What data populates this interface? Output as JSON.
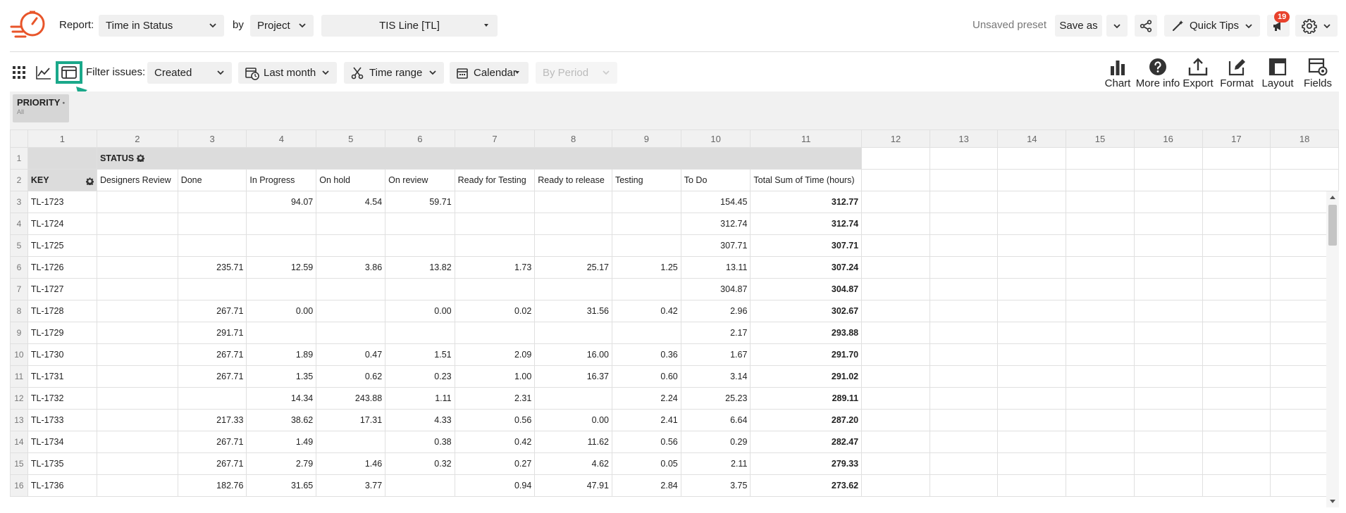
{
  "header": {
    "report_label": "Report:",
    "report_value": "Time in Status",
    "by_label": "by",
    "by_value": "Project",
    "project_value": "TIS Line [TL]",
    "unsaved_preset": "Unsaved preset",
    "save_as": "Save as",
    "quick_tips": "Quick Tips",
    "notification_count": "19"
  },
  "toolbar": {
    "filter_label": "Filter issues:",
    "filter_value": "Created",
    "date_range": "Last month",
    "time_range": "Time range",
    "calendar": "Calendar",
    "by_period": "By Period",
    "actions": {
      "chart": "Chart",
      "more_info": "More info",
      "export": "Export",
      "format": "Format",
      "layout": "Layout",
      "fields": "Fields"
    }
  },
  "filter_pill": {
    "title": "PRIORITY",
    "sub": "All"
  },
  "grid": {
    "col_numbers": [
      "1",
      "2",
      "3",
      "4",
      "5",
      "6",
      "7",
      "8",
      "9",
      "10",
      "11",
      "12",
      "13",
      "14",
      "15",
      "16",
      "17",
      "18"
    ],
    "status_label": "STATUS",
    "key_label": "KEY",
    "columns": [
      "Designers Review",
      "Done",
      "In Progress",
      "On hold",
      "On review",
      "Ready for Testing",
      "Ready to release",
      "Testing",
      "To Do",
      "Total Sum of Time (hours)"
    ],
    "rows": [
      {
        "n": "3",
        "key": "TL-1723",
        "v": [
          "",
          "",
          "94.07",
          "4.54",
          "59.71",
          "",
          "",
          "",
          "154.45",
          "312.77"
        ]
      },
      {
        "n": "4",
        "key": "TL-1724",
        "v": [
          "",
          "",
          "",
          "",
          "",
          "",
          "",
          "",
          "312.74",
          "312.74"
        ]
      },
      {
        "n": "5",
        "key": "TL-1725",
        "v": [
          "",
          "",
          "",
          "",
          "",
          "",
          "",
          "",
          "307.71",
          "307.71"
        ]
      },
      {
        "n": "6",
        "key": "TL-1726",
        "v": [
          "",
          "235.71",
          "12.59",
          "3.86",
          "13.82",
          "1.73",
          "25.17",
          "1.25",
          "13.11",
          "307.24"
        ]
      },
      {
        "n": "7",
        "key": "TL-1727",
        "v": [
          "",
          "",
          "",
          "",
          "",
          "",
          "",
          "",
          "304.87",
          "304.87"
        ]
      },
      {
        "n": "8",
        "key": "TL-1728",
        "v": [
          "",
          "267.71",
          "0.00",
          "",
          "0.00",
          "0.02",
          "31.56",
          "0.42",
          "2.96",
          "302.67"
        ]
      },
      {
        "n": "9",
        "key": "TL-1729",
        "v": [
          "",
          "291.71",
          "",
          "",
          "",
          "",
          "",
          "",
          "2.17",
          "293.88"
        ]
      },
      {
        "n": "10",
        "key": "TL-1730",
        "v": [
          "",
          "267.71",
          "1.89",
          "0.47",
          "1.51",
          "2.09",
          "16.00",
          "0.36",
          "1.67",
          "291.70"
        ]
      },
      {
        "n": "11",
        "key": "TL-1731",
        "v": [
          "",
          "267.71",
          "1.35",
          "0.62",
          "0.23",
          "1.00",
          "16.37",
          "0.60",
          "3.14",
          "291.02"
        ]
      },
      {
        "n": "12",
        "key": "TL-1732",
        "v": [
          "",
          "",
          "14.34",
          "243.88",
          "1.11",
          "2.31",
          "",
          "2.24",
          "25.23",
          "289.11"
        ]
      },
      {
        "n": "13",
        "key": "TL-1733",
        "v": [
          "",
          "217.33",
          "38.62",
          "17.31",
          "4.33",
          "0.56",
          "0.00",
          "2.41",
          "6.64",
          "287.20"
        ]
      },
      {
        "n": "14",
        "key": "TL-1734",
        "v": [
          "",
          "267.71",
          "1.49",
          "",
          "0.38",
          "0.42",
          "11.62",
          "0.56",
          "0.29",
          "282.47"
        ]
      },
      {
        "n": "15",
        "key": "TL-1735",
        "v": [
          "",
          "267.71",
          "2.79",
          "1.46",
          "0.32",
          "0.27",
          "4.62",
          "0.05",
          "2.11",
          "279.33"
        ]
      },
      {
        "n": "16",
        "key": "TL-1736",
        "v": [
          "",
          "182.76",
          "31.65",
          "3.77",
          "",
          "0.94",
          "47.91",
          "2.84",
          "3.75",
          "273.62"
        ]
      }
    ]
  },
  "colors": {
    "accent": "#1aa88a",
    "badge": "#e8412c",
    "logo": "#e8552a"
  }
}
